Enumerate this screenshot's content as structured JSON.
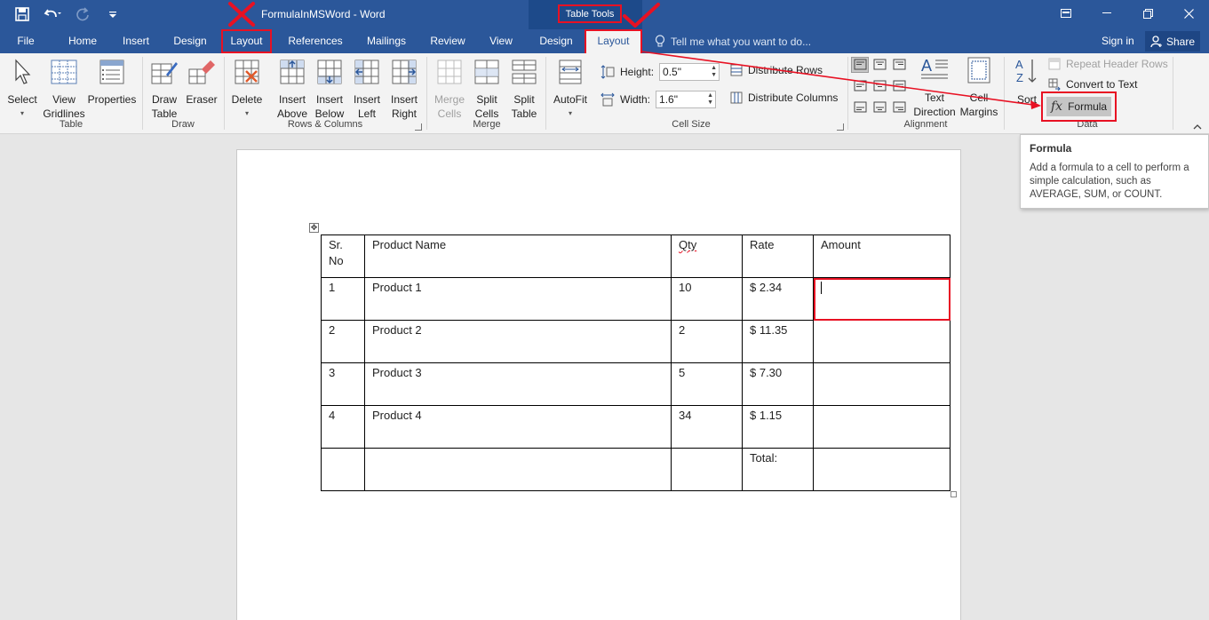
{
  "window": {
    "title": "FormulaInMSWord - Word",
    "contextual_group": "Table Tools"
  },
  "tabs": {
    "file": "File",
    "home": "Home",
    "insert": "Insert",
    "design": "Design",
    "layout": "Layout",
    "references": "References",
    "mailings": "Mailings",
    "review": "Review",
    "view": "View",
    "table_design": "Design",
    "table_layout": "Layout",
    "tell_me": "Tell me what you want to do...",
    "sign_in": "Sign in",
    "share": "Share"
  },
  "ribbon": {
    "table_group": {
      "label": "Table",
      "select": "Select",
      "view_gridlines_1": "View",
      "view_gridlines_2": "Gridlines",
      "properties": "Properties"
    },
    "draw_group": {
      "label": "Draw",
      "draw_table_1": "Draw",
      "draw_table_2": "Table",
      "eraser": "Eraser"
    },
    "rows_cols_group": {
      "label": "Rows & Columns",
      "delete": "Delete",
      "insert_above_1": "Insert",
      "insert_above_2": "Above",
      "insert_below_1": "Insert",
      "insert_below_2": "Below",
      "insert_left_1": "Insert",
      "insert_left_2": "Left",
      "insert_right_1": "Insert",
      "insert_right_2": "Right"
    },
    "merge_group": {
      "label": "Merge",
      "merge_cells_1": "Merge",
      "merge_cells_2": "Cells",
      "split_cells_1": "Split",
      "split_cells_2": "Cells",
      "split_table_1": "Split",
      "split_table_2": "Table"
    },
    "cell_size_group": {
      "label": "Cell Size",
      "autofit": "AutoFit",
      "height_label": "Height:",
      "height_value": "0.5\"",
      "width_label": "Width:",
      "width_value": "1.6\"",
      "distribute_rows": "Distribute Rows",
      "distribute_columns": "Distribute Columns"
    },
    "alignment_group": {
      "label": "Alignment",
      "text_direction_1": "Text",
      "text_direction_2": "Direction",
      "cell_margins_1": "Cell",
      "cell_margins_2": "Margins"
    },
    "data_group": {
      "label": "Data",
      "sort": "Sort",
      "repeat_header_rows": "Repeat Header Rows",
      "convert_to_text": "Convert to Text",
      "formula": "Formula"
    }
  },
  "tooltip": {
    "title": "Formula",
    "body": "Add a formula to a cell to perform a simple calculation, such as AVERAGE, SUM, or COUNT."
  },
  "table": {
    "headers": {
      "sr_1": "Sr.",
      "sr_2": "No",
      "product": "Product Name",
      "qty": "Qty",
      "rate": "Rate",
      "amount": "Amount"
    },
    "rows": [
      {
        "sr": "1",
        "product": "Product 1",
        "qty": "10",
        "rate": "$ 2.34",
        "amount": ""
      },
      {
        "sr": "2",
        "product": "Product 2",
        "qty": "2",
        "rate": "$ 11.35",
        "amount": ""
      },
      {
        "sr": "3",
        "product": "Product 3",
        "qty": "5",
        "rate": "$ 7.30",
        "amount": ""
      },
      {
        "sr": "4",
        "product": "Product 4",
        "qty": "34",
        "rate": "$ 1.15",
        "amount": ""
      }
    ],
    "total_label": "Total:"
  },
  "colors": {
    "brand_blue": "#2b579a",
    "annotation_red": "#e81123"
  }
}
